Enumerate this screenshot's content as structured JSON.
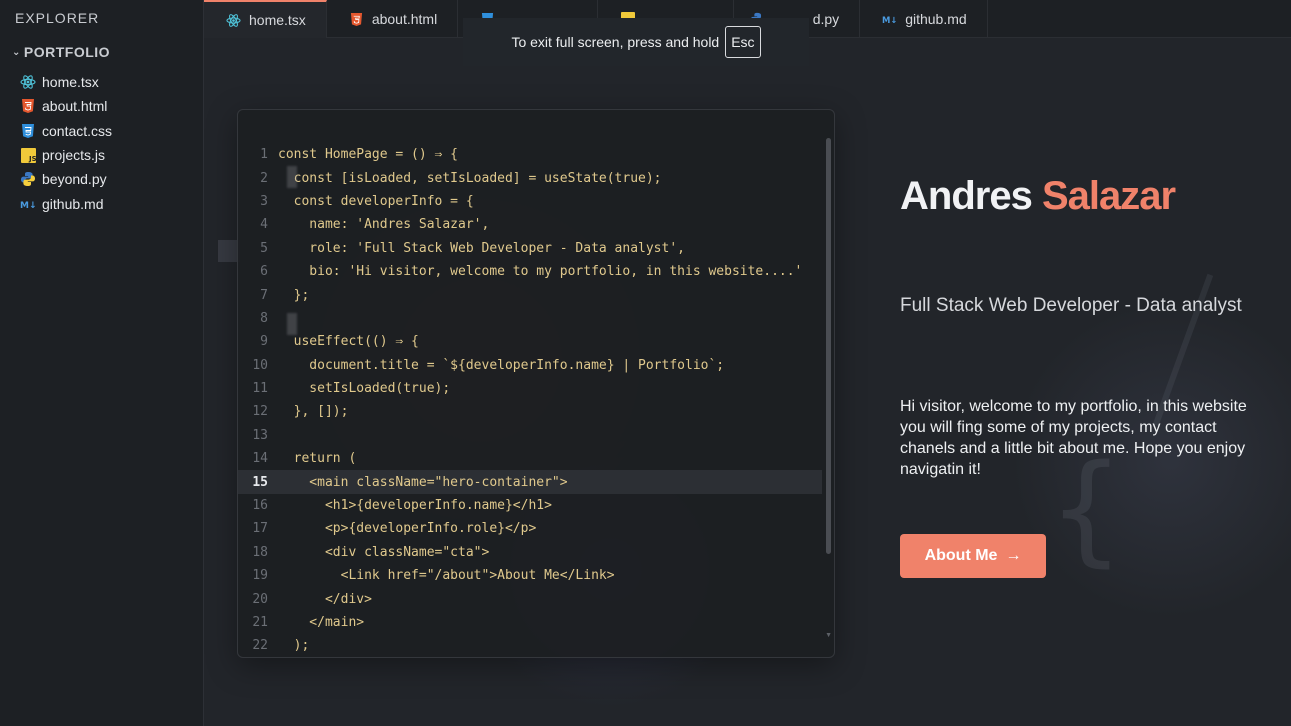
{
  "sidebar": {
    "title": "EXPLORER",
    "folder": "PORTFOLIO",
    "files": [
      {
        "name": "home.tsx",
        "icon": "react-icon"
      },
      {
        "name": "about.html",
        "icon": "html5-icon"
      },
      {
        "name": "contact.css",
        "icon": "css3-icon"
      },
      {
        "name": "projects.js",
        "icon": "javascript-icon"
      },
      {
        "name": "beyond.py",
        "icon": "python-icon"
      },
      {
        "name": "github.md",
        "icon": "markdown-icon"
      }
    ]
  },
  "tabs": [
    {
      "label": "home.tsx",
      "active": true
    },
    {
      "label": "about.html",
      "active": false
    },
    {
      "label": "",
      "active": false
    },
    {
      "label": "",
      "active": false
    },
    {
      "label": "d.py",
      "active": false
    },
    {
      "label": "github.md",
      "active": false
    }
  ],
  "fullscreen_notice": {
    "text": "To exit full screen, press and hold",
    "key": "Esc"
  },
  "code_editor": {
    "highlighted_line": 15,
    "lines": [
      {
        "n": "1",
        "t": "const HomePage = () ⇒ {"
      },
      {
        "n": "2",
        "t": "  const [isLoaded, setIsLoaded] = useState(true);"
      },
      {
        "n": "3",
        "t": "  const developerInfo = {"
      },
      {
        "n": "4",
        "t": "    name: 'Andres Salazar',"
      },
      {
        "n": "5",
        "t": "    role: 'Full Stack Web Developer - Data analyst',"
      },
      {
        "n": "6",
        "t": "    bio: 'Hi visitor, welcome to my portfolio, in this website....'"
      },
      {
        "n": "7",
        "t": "  };"
      },
      {
        "n": "8",
        "t": ""
      },
      {
        "n": "9",
        "t": "  useEffect(() ⇒ {"
      },
      {
        "n": "10",
        "t": "    document.title = `${developerInfo.name} | Portfolio`;"
      },
      {
        "n": "11",
        "t": "    setIsLoaded(true);"
      },
      {
        "n": "12",
        "t": "  }, []);"
      },
      {
        "n": "13",
        "t": ""
      },
      {
        "n": "14",
        "t": "  return ("
      },
      {
        "n": "15",
        "t": "    <main className=\"hero-container\">"
      },
      {
        "n": "16",
        "t": "      <h1>{developerInfo.name}</h1>"
      },
      {
        "n": "17",
        "t": "      <p>{developerInfo.role}</p>"
      },
      {
        "n": "18",
        "t": "      <div className=\"cta\">"
      },
      {
        "n": "19",
        "t": "        <Link href=\"/about\">About Me</Link>"
      },
      {
        "n": "20",
        "t": "      </div>"
      },
      {
        "n": "21",
        "t": "    </main>"
      },
      {
        "n": "22",
        "t": "  );"
      }
    ]
  },
  "hero": {
    "first_name": "Andres",
    "last_name": "Salazar",
    "role": "Full Stack Web Developer - Data analyst",
    "bio": "Hi visitor, welcome to my portfolio, in this website you will fing some of my projects, my contact chanels and a little bit about me. Hope you enjoy navigatin it!",
    "cta_label": "About Me",
    "cta_arrow": "→"
  },
  "colors": {
    "accent": "#f0826a",
    "background": "#22252a",
    "sidebar": "#1d2024"
  }
}
